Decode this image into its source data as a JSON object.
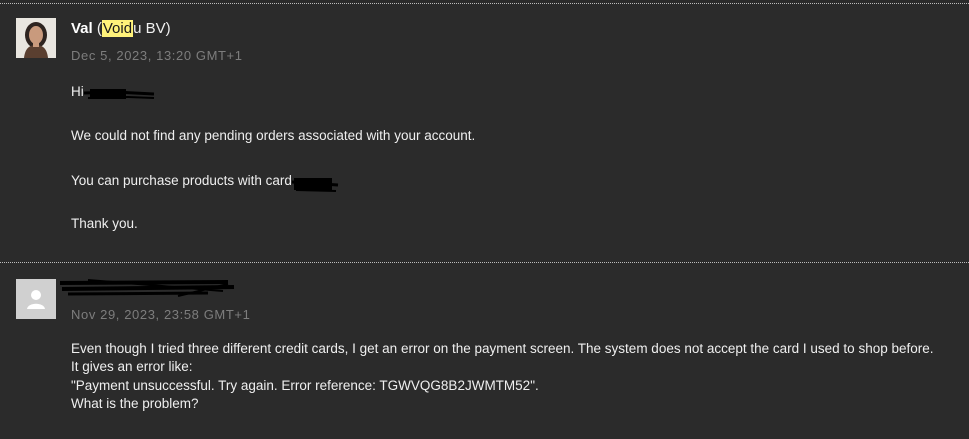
{
  "messages": [
    {
      "sender_name": "Val",
      "company_open": "(",
      "company_highlight": "Void",
      "company_rest": "u BV)",
      "timestamp": "Dec 5, 2023, 13:20 GMT+1",
      "greeting": "Hi",
      "body": [
        "We could not find any pending orders associated with your account.",
        "You can purchase products with card",
        "Thank you."
      ]
    },
    {
      "timestamp": "Nov 29, 2023, 23:58 GMT+1",
      "body": [
        "Even though I tried three different credit cards, I get an error on the payment screen. The system does not accept the card I used to shop before.",
        "It gives an error like:",
        "\"Payment unsuccessful. Try again. Error reference: TGWVQG8B2JWMTM52\".",
        "What is the problem?"
      ]
    }
  ],
  "colors": {
    "background": "#2b2b2b",
    "text": "#efefef",
    "timestamp": "#7d7d7d",
    "highlight": "#fff27a"
  }
}
